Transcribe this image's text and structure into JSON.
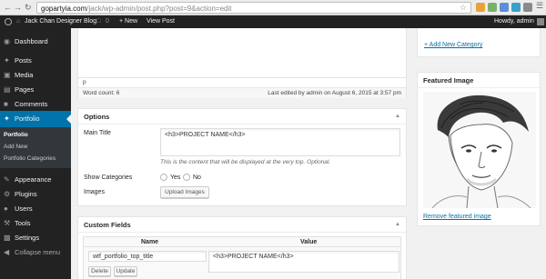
{
  "browser": {
    "url_domain": "gopartyia.com",
    "url_path": "/jack/wp-admin/post.php?post=9&action=edit"
  },
  "adminbar": {
    "site_name": "Jack Chan Designer Blog",
    "comments_count": "0",
    "new_label": "+ New",
    "view_post_label": "View Post",
    "howdy": "Howdy, admin"
  },
  "sidebar": {
    "items": [
      {
        "label": "Dashboard",
        "icon": "dashboard-icon"
      },
      {
        "label": "Posts",
        "icon": "pin-icon"
      },
      {
        "label": "Media",
        "icon": "media-icon"
      },
      {
        "label": "Pages",
        "icon": "pages-icon"
      },
      {
        "label": "Comments",
        "icon": "comments-icon"
      },
      {
        "label": "Portfolio",
        "icon": "portfolio-icon"
      },
      {
        "label": "Appearance",
        "icon": "brush-icon"
      },
      {
        "label": "Plugins",
        "icon": "plugin-icon"
      },
      {
        "label": "Users",
        "icon": "users-icon"
      },
      {
        "label": "Tools",
        "icon": "tools-icon"
      },
      {
        "label": "Settings",
        "icon": "settings-icon"
      },
      {
        "label": "Collapse menu",
        "icon": "collapse-icon"
      }
    ],
    "submenu": [
      "Portfolio",
      "Add New",
      "Portfolio Categories"
    ]
  },
  "editor": {
    "path": "p",
    "word_count": "Word count: 6",
    "last_edited": "Last edited by admin on August 6, 2015 at 3:57 pm"
  },
  "options_box": {
    "title": "Options",
    "main_title_label": "Main Title",
    "main_title_value": "<h3>PROJECT NAME</h3>",
    "main_title_desc": "This is the content that will be displayed at the very top. Optional.",
    "show_categories_label": "Show Categories",
    "yes_label": "Yes",
    "no_label": "No",
    "images_label": "Images",
    "upload_images_label": "Upload Images"
  },
  "custom_fields": {
    "title": "Custom Fields",
    "col_name": "Name",
    "col_value": "Value",
    "row_name": "wtf_portfolio_top_title",
    "row_value": "<h3>PROJECT NAME</h3>",
    "delete_label": "Delete",
    "update_label": "Update"
  },
  "right_column": {
    "add_category_link": "+ Add New Category",
    "featured_image_title": "Featured Image",
    "remove_featured_link": "Remove featured image"
  },
  "colors": {
    "admin_bar": "#222222",
    "active_menu": "#0073aa",
    "link": "#0073aa"
  }
}
